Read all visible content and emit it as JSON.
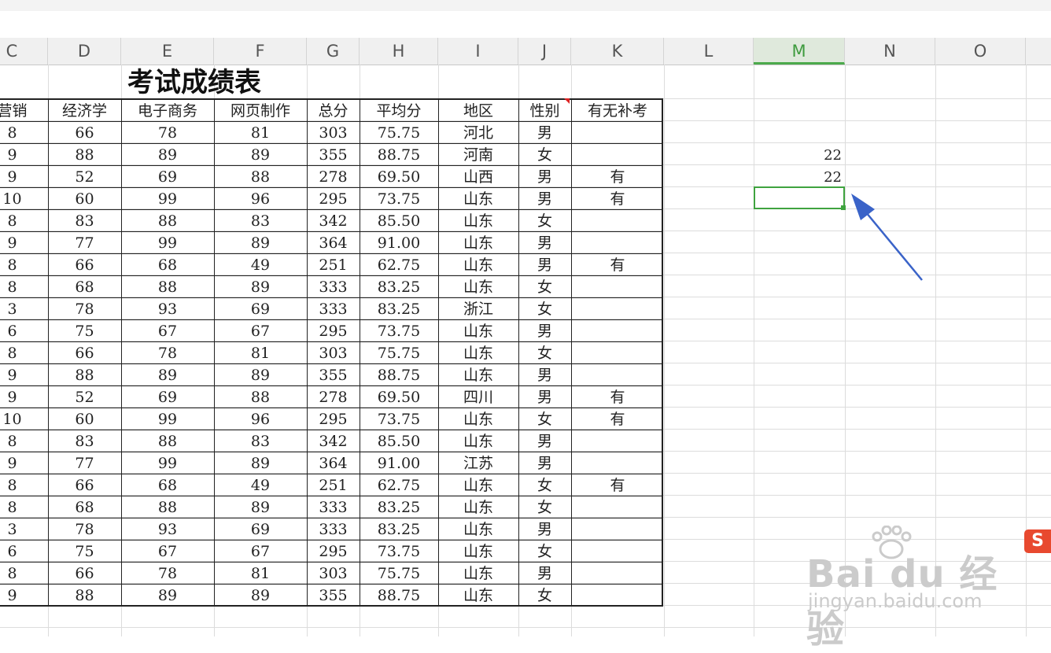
{
  "columns": [
    "C",
    "D",
    "E",
    "F",
    "G",
    "H",
    "I",
    "J",
    "K",
    "L",
    "M",
    "N",
    "O"
  ],
  "selected_column": "M",
  "table": {
    "title": "考试成绩表",
    "headers": [
      "营销",
      "经济学",
      "电子商务",
      "网页制作",
      "总分",
      "平均分",
      "地区",
      "性别",
      "有无补考"
    ],
    "rows": [
      [
        "8",
        "66",
        "78",
        "81",
        "303",
        "75.75",
        "河北",
        "男",
        ""
      ],
      [
        "9",
        "88",
        "89",
        "89",
        "355",
        "88.75",
        "河南",
        "女",
        ""
      ],
      [
        "9",
        "52",
        "69",
        "88",
        "278",
        "69.50",
        "山西",
        "男",
        "有"
      ],
      [
        "10",
        "60",
        "99",
        "96",
        "295",
        "73.75",
        "山东",
        "男",
        "有"
      ],
      [
        "8",
        "83",
        "88",
        "83",
        "342",
        "85.50",
        "山东",
        "女",
        ""
      ],
      [
        "9",
        "77",
        "99",
        "89",
        "364",
        "91.00",
        "山东",
        "男",
        ""
      ],
      [
        "8",
        "66",
        "68",
        "49",
        "251",
        "62.75",
        "山东",
        "男",
        "有"
      ],
      [
        "8",
        "68",
        "88",
        "89",
        "333",
        "83.25",
        "山东",
        "女",
        ""
      ],
      [
        "3",
        "78",
        "93",
        "69",
        "333",
        "83.25",
        "浙江",
        "女",
        ""
      ],
      [
        "6",
        "75",
        "67",
        "67",
        "295",
        "73.75",
        "山东",
        "男",
        ""
      ],
      [
        "8",
        "66",
        "78",
        "81",
        "303",
        "75.75",
        "山东",
        "女",
        ""
      ],
      [
        "9",
        "88",
        "89",
        "89",
        "355",
        "88.75",
        "山东",
        "男",
        ""
      ],
      [
        "9",
        "52",
        "69",
        "88",
        "278",
        "69.50",
        "四川",
        "男",
        "有"
      ],
      [
        "10",
        "60",
        "99",
        "96",
        "295",
        "73.75",
        "山东",
        "女",
        "有"
      ],
      [
        "8",
        "83",
        "88",
        "83",
        "342",
        "85.50",
        "山东",
        "男",
        ""
      ],
      [
        "9",
        "77",
        "99",
        "89",
        "364",
        "91.00",
        "江苏",
        "男",
        ""
      ],
      [
        "8",
        "66",
        "68",
        "49",
        "251",
        "62.75",
        "山东",
        "女",
        "有"
      ],
      [
        "8",
        "68",
        "88",
        "89",
        "333",
        "83.25",
        "山东",
        "女",
        ""
      ],
      [
        "3",
        "78",
        "93",
        "69",
        "333",
        "83.25",
        "山东",
        "男",
        ""
      ],
      [
        "6",
        "75",
        "67",
        "67",
        "295",
        "73.75",
        "山东",
        "女",
        ""
      ],
      [
        "8",
        "66",
        "78",
        "81",
        "303",
        "75.75",
        "山东",
        "男",
        ""
      ],
      [
        "9",
        "88",
        "89",
        "89",
        "355",
        "88.75",
        "山东",
        "女",
        ""
      ]
    ]
  },
  "m_column_values": [
    "22",
    "22"
  ],
  "watermark": {
    "brand": "Bai du 经验",
    "url": "jingyan.baidu.com"
  },
  "ime_badge": "S",
  "colors": {
    "selection": "#3fa33f",
    "arrow": "#3a63c8",
    "header_bg": "#f0f0f0"
  }
}
